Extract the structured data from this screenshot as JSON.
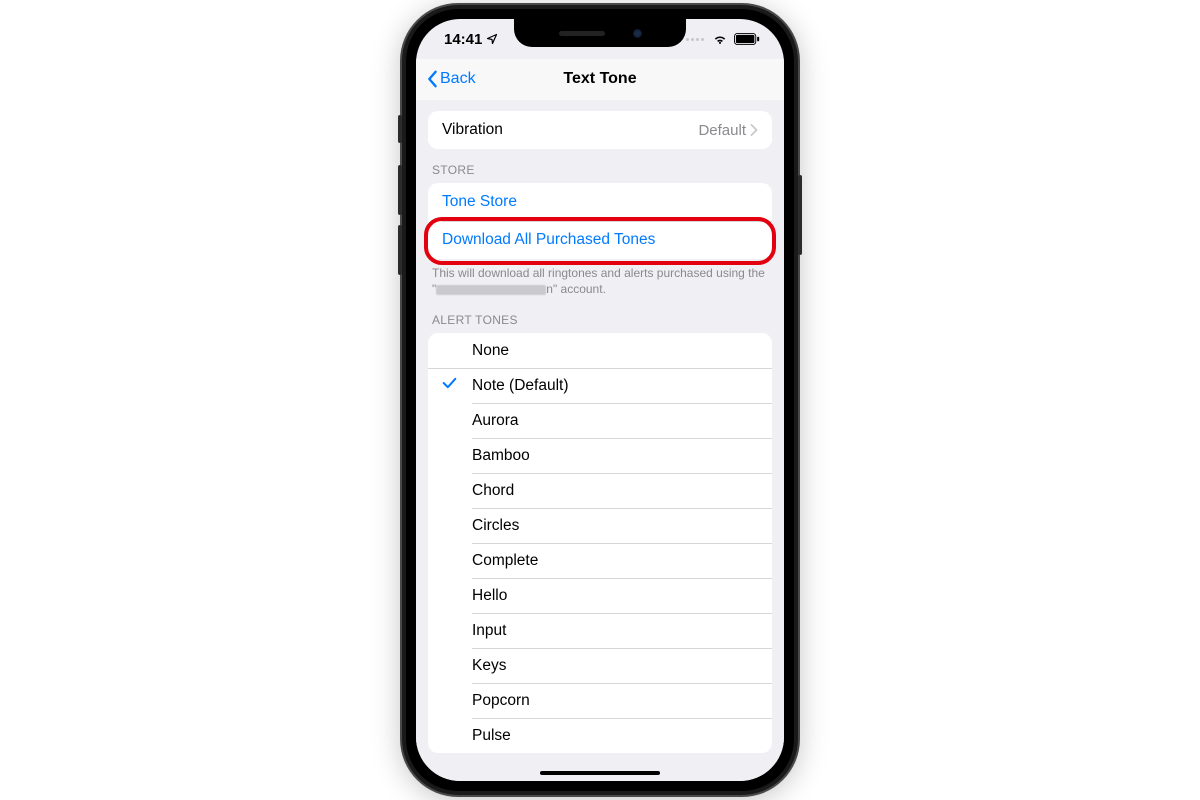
{
  "status": {
    "time": "14:41"
  },
  "nav": {
    "back_label": "Back",
    "title": "Text Tone"
  },
  "vibration": {
    "label": "Vibration",
    "value": "Default"
  },
  "store": {
    "header": "STORE",
    "tone_store": "Tone Store",
    "download_all": "Download All Purchased Tones",
    "footer_prefix": "This will download all ringtones and alerts purchased using the \"",
    "footer_suffix": "n\" account."
  },
  "alert_tones": {
    "header": "ALERT TONES",
    "selected_index": 1,
    "items": [
      "None",
      "Note (Default)",
      "Aurora",
      "Bamboo",
      "Chord",
      "Circles",
      "Complete",
      "Hello",
      "Input",
      "Keys",
      "Popcorn",
      "Pulse"
    ]
  },
  "colors": {
    "ios_blue": "#007aff",
    "highlight_red": "#e3000f",
    "bg": "#efeff4",
    "secondary_text": "#8a8a8e"
  }
}
